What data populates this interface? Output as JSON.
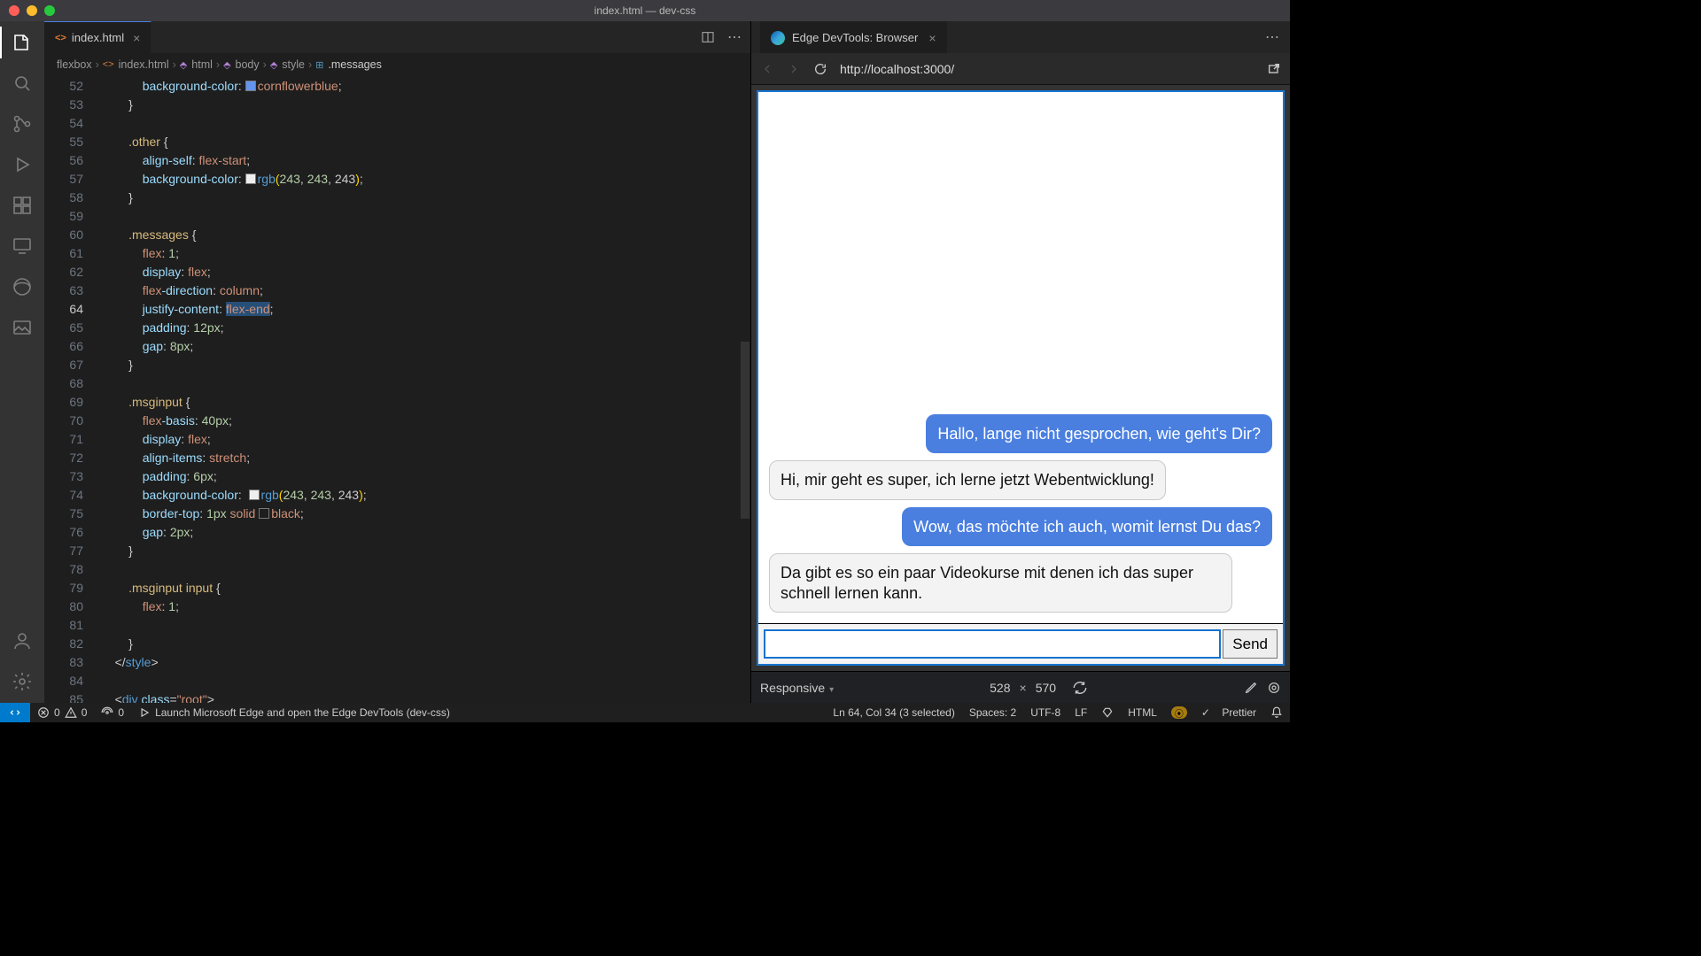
{
  "window": {
    "title": "index.html — dev-css"
  },
  "editor": {
    "tab_filename": "index.html",
    "breadcrumbs": [
      "flexbox",
      "index.html",
      "html",
      "body",
      "style",
      ".messages"
    ],
    "first_line_number": 52,
    "current_line_number": 64,
    "lines_raw": [
      "            background-color: ▮cornflowerblue;",
      "        }",
      "",
      "        .other {",
      "            align-self: flex-start;",
      "            background-color: ▮rgb(243, 243, 243);",
      "        }",
      "",
      "        .messages {",
      "            flex: 1;",
      "            display: flex;",
      "            flex-direction: column;",
      "            justify-content: flex-end;",
      "            padding: 12px;",
      "            gap: 8px;",
      "        }",
      "",
      "        .msginput {",
      "            flex-basis: 40px;",
      "            display: flex;",
      "            align-items: stretch;",
      "            padding: 6px;",
      "            background-color:  ▮rgb(243, 243, 243);",
      "            border-top: 1px solid ▯black;",
      "            gap: 2px;",
      "        }",
      "",
      "        .msginput input {",
      "            flex: 1;",
      "",
      "        }",
      "    </style>",
      "",
      "    <div class=\"root\">"
    ]
  },
  "devtools": {
    "tab_title": "Edge DevTools: Browser",
    "url": "http://localhost:3000/",
    "footer": {
      "mode": "Responsive",
      "width": "528",
      "height": "570"
    }
  },
  "chat": {
    "messages": [
      {
        "kind": "mine",
        "text": "Hallo, lange nicht gesprochen, wie geht's Dir?"
      },
      {
        "kind": "other",
        "text": "Hi, mir geht es super, ich lerne jetzt Webentwicklung!"
      },
      {
        "kind": "mine",
        "text": "Wow, das möchte ich auch, womit lernst Du das?"
      },
      {
        "kind": "other",
        "text": "Da gibt es so ein paar Videokurse mit denen ich das super schnell lernen kann."
      }
    ],
    "send_label": "Send",
    "input_value": ""
  },
  "status": {
    "errors": "0",
    "warnings": "0",
    "ports": "0",
    "launch_hint": "Launch Microsoft Edge and open the Edge DevTools (dev-css)",
    "cursor": "Ln 64, Col 34 (3 selected)",
    "spaces": "Spaces: 2",
    "encoding": "UTF-8",
    "eol": "LF",
    "lang": "HTML",
    "formatter": "Prettier"
  },
  "colors": {
    "msg_mine": "#4a7fe0",
    "msg_other": "#f3f3f3"
  }
}
